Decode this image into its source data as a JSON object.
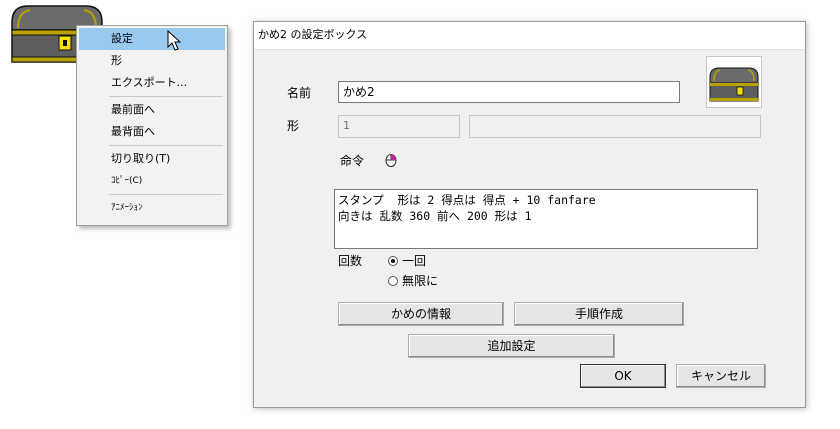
{
  "context_menu": {
    "items": [
      {
        "label": "設定"
      },
      {
        "label": "形"
      },
      {
        "label": "エクスポート..."
      },
      {
        "label": "最前面へ"
      },
      {
        "label": "最背面へ"
      },
      {
        "label": "切り取り(T)"
      },
      {
        "label": "ｺﾋﾟｰ(C)"
      },
      {
        "label": "ｱﾆﾒｰｼｮﾝ"
      }
    ],
    "selected_index": 0
  },
  "dialog": {
    "title": "かめ2 の設定ボックス",
    "name_label": "名前",
    "name_value": "かめ2",
    "shape_label": "形",
    "shape_value": "1",
    "shape_extra": "",
    "command_label": "命令",
    "command_lines": [
      "スタンプ  形は 2 得点は 得点 + 10 fanfare",
      "向きは 乱数 360 前へ 200 形は 1"
    ],
    "count_label": "回数",
    "count_options": [
      {
        "label": "一回",
        "selected": true
      },
      {
        "label": "無限に",
        "selected": false
      }
    ],
    "buttons": {
      "info": "かめの情報",
      "procedure": "手順作成",
      "extra": "追加設定",
      "ok": "OK",
      "cancel": "キャンセル"
    }
  },
  "colors": {
    "menu_highlight": "#99c9ef",
    "chest_body": "#6b6b6b",
    "chest_trim": "#b8a300"
  }
}
